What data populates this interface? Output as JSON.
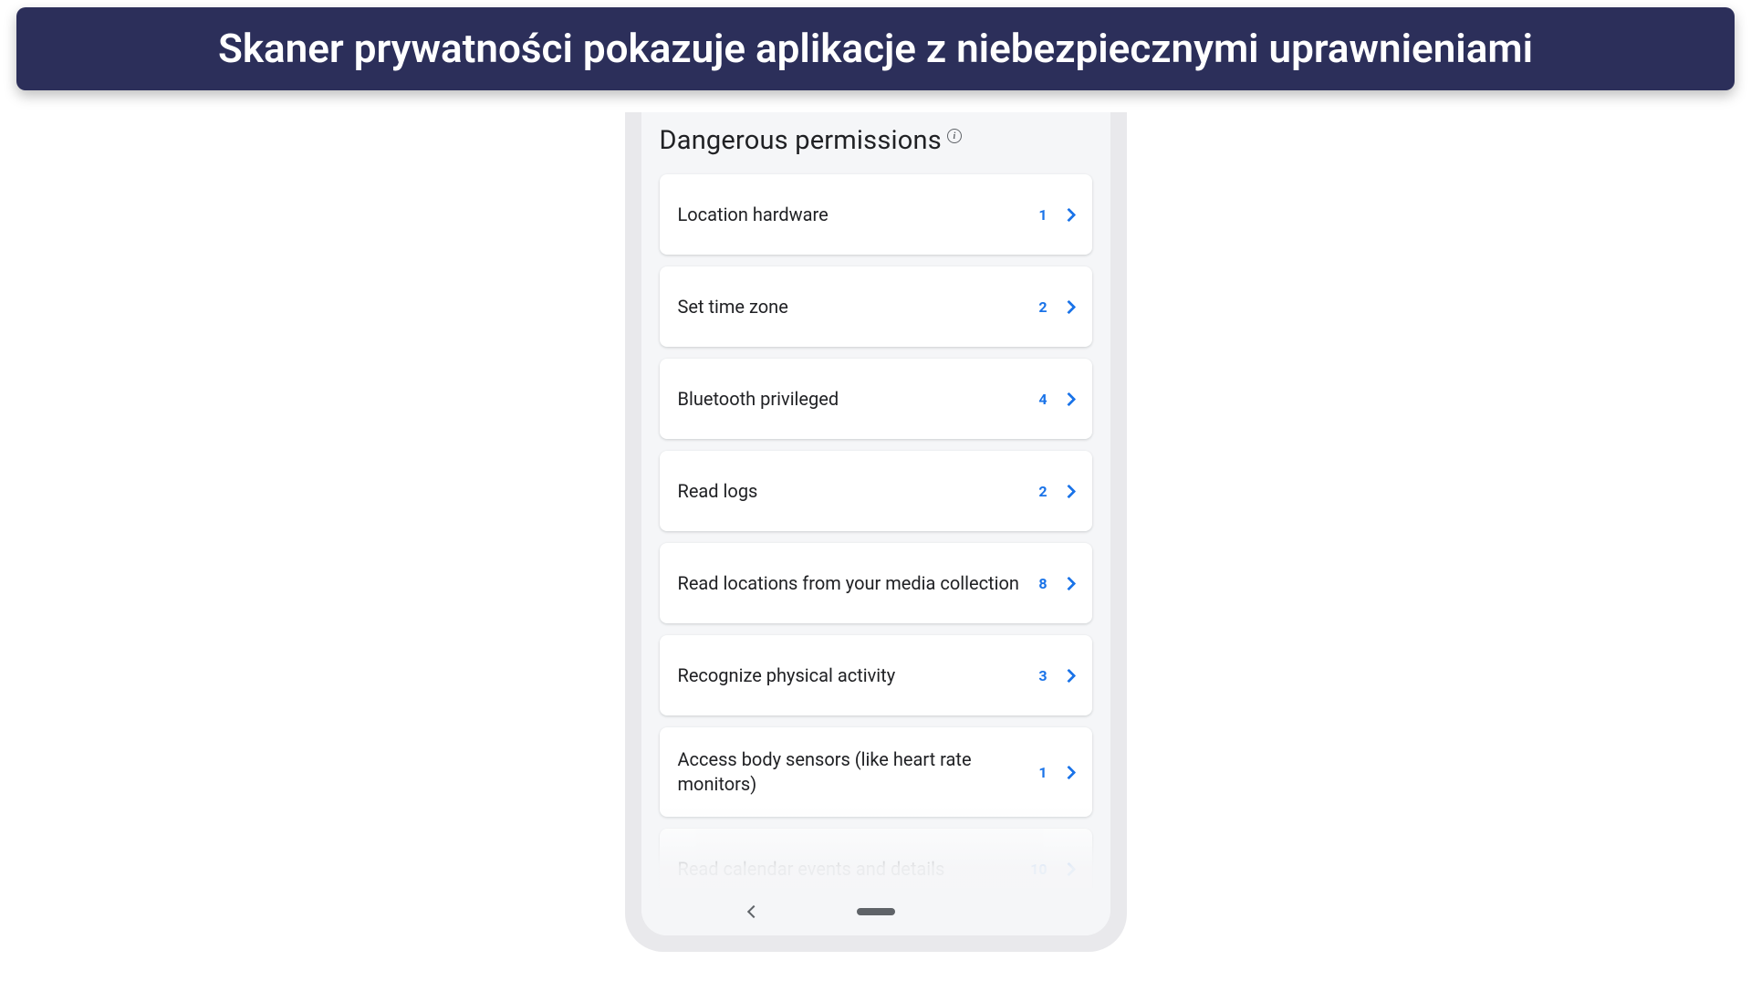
{
  "banner": {
    "title": "Skaner prywatności pokazuje aplikacje z niebezpiecznymi uprawnieniami"
  },
  "screen": {
    "section_title": "Dangerous permissions",
    "permissions": [
      {
        "label": "Location hardware",
        "count": "1"
      },
      {
        "label": "Set time zone",
        "count": "2"
      },
      {
        "label": "Bluetooth privileged",
        "count": "4"
      },
      {
        "label": "Read logs",
        "count": "2"
      },
      {
        "label": "Read locations from your media collection",
        "count": "8"
      },
      {
        "label": "Recognize physical activity",
        "count": "3"
      },
      {
        "label": "Access body sensors (like heart rate monitors)",
        "count": "1"
      },
      {
        "label": "Read calendar events and details",
        "count": "10"
      }
    ]
  },
  "colors": {
    "banner_bg": "#2c2f5a",
    "accent": "#1a73e8",
    "text_primary": "#202124"
  }
}
